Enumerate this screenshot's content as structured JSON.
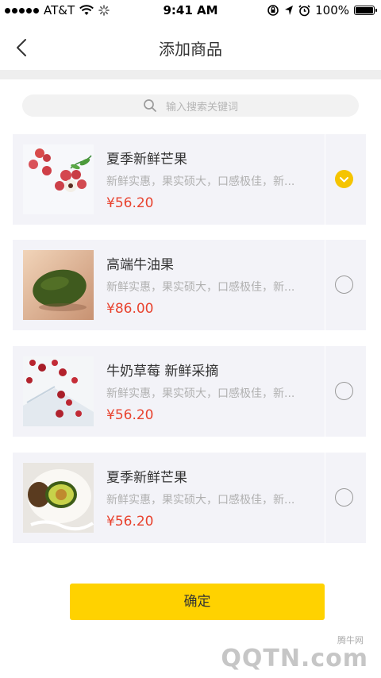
{
  "status_bar": {
    "carrier": "AT&T",
    "time": "9:41 AM",
    "battery": "100%"
  },
  "nav": {
    "title": "添加商品"
  },
  "search": {
    "placeholder": "输入搜索关键词"
  },
  "products": [
    {
      "title": "夏季新鲜芒果",
      "desc": "新鲜实惠，果实硕大，口感极佳，新...",
      "price": "¥56.20",
      "checked": true,
      "image": "lychee-photo"
    },
    {
      "title": "高端牛油果",
      "desc": "新鲜实惠，果实硕大，口感极佳，新...",
      "price": "¥86.00",
      "checked": false,
      "image": "avocado-photo"
    },
    {
      "title": "牛奶草莓 新鲜采摘",
      "desc": "新鲜实惠，果实硕大，口感极佳，新...",
      "price": "¥56.20",
      "checked": false,
      "image": "cranberries-photo"
    },
    {
      "title": "夏季新鲜芒果",
      "desc": "新鲜实惠，果实硕大，口感极佳，新...",
      "price": "¥56.20",
      "checked": false,
      "image": "kiwi-avocado-splash-photo"
    }
  ],
  "confirm": {
    "label": "确定"
  },
  "watermark": {
    "small": "腾牛网",
    "big": "QQTN.com"
  },
  "colors": {
    "accent": "#ffd200",
    "price": "#e8432f",
    "card_bg": "#f3f3f8",
    "checked": "#f5c400"
  }
}
